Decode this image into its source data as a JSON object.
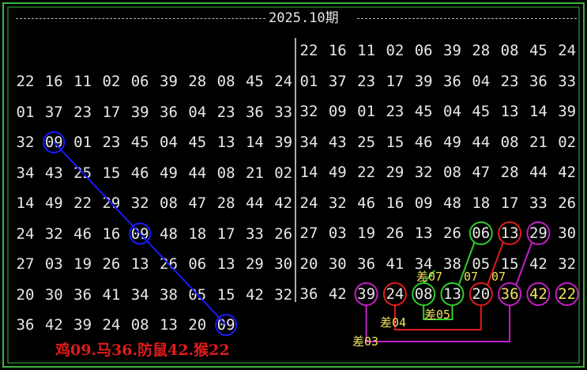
{
  "title": "2025.10期",
  "left_grid": [
    [
      "22",
      "16",
      "11",
      "02",
      "06",
      "39",
      "28",
      "08",
      "45",
      "24"
    ],
    [
      "01",
      "37",
      "23",
      "17",
      "39",
      "36",
      "04",
      "23",
      "36",
      "33"
    ],
    [
      "32",
      "09",
      "01",
      "23",
      "45",
      "04",
      "45",
      "13",
      "14",
      "39"
    ],
    [
      "34",
      "43",
      "25",
      "15",
      "46",
      "49",
      "44",
      "08",
      "21",
      "02"
    ],
    [
      "14",
      "49",
      "22",
      "29",
      "32",
      "08",
      "47",
      "28",
      "44",
      "42"
    ],
    [
      "24",
      "32",
      "46",
      "16",
      "09",
      "48",
      "18",
      "17",
      "33",
      "26"
    ],
    [
      "27",
      "03",
      "19",
      "26",
      "13",
      "26",
      "06",
      "13",
      "29",
      "30"
    ],
    [
      "20",
      "30",
      "36",
      "41",
      "34",
      "38",
      "05",
      "15",
      "42",
      "32"
    ],
    [
      "36",
      "42",
      "39",
      "24",
      "08",
      "13",
      "20",
      "09"
    ]
  ],
  "right_grid": [
    [
      "22",
      "16",
      "11",
      "02",
      "06",
      "39",
      "28",
      "08",
      "45",
      "24"
    ],
    [
      "01",
      "37",
      "23",
      "17",
      "39",
      "36",
      "04",
      "23",
      "36",
      "33"
    ],
    [
      "32",
      "09",
      "01",
      "23",
      "45",
      "04",
      "45",
      "13",
      "14",
      "39"
    ],
    [
      "34",
      "43",
      "25",
      "15",
      "46",
      "49",
      "44",
      "08",
      "21",
      "02"
    ],
    [
      "14",
      "49",
      "22",
      "29",
      "32",
      "08",
      "47",
      "28",
      "44",
      "42"
    ],
    [
      "24",
      "32",
      "46",
      "16",
      "09",
      "48",
      "18",
      "17",
      "33",
      "26"
    ],
    [
      "27",
      "03",
      "19",
      "26",
      "13",
      "26",
      "06",
      "13",
      "29",
      "30"
    ],
    [
      "20",
      "30",
      "36",
      "41",
      "34",
      "38",
      "05",
      "15",
      "42",
      "32"
    ],
    [
      "36",
      "42",
      "39",
      "24",
      "08",
      "13",
      "20",
      "36",
      "42",
      "22"
    ]
  ],
  "annotations": {
    "diff_07_a": "差07",
    "diff_07_b": "07",
    "diff_07_c": "07",
    "diff_05": "差05",
    "diff_04": "差04",
    "diff_03": "差03"
  },
  "bottom_text": "鸡09.马36.防鼠42.猴22",
  "colors": {
    "background": "#000000",
    "border": "#3cb43c",
    "blue": "#1a1aff",
    "red": "#e01b1b",
    "green": "#2ecc2e",
    "magenta": "#c21fc2",
    "yellow": "#f2e25c"
  }
}
